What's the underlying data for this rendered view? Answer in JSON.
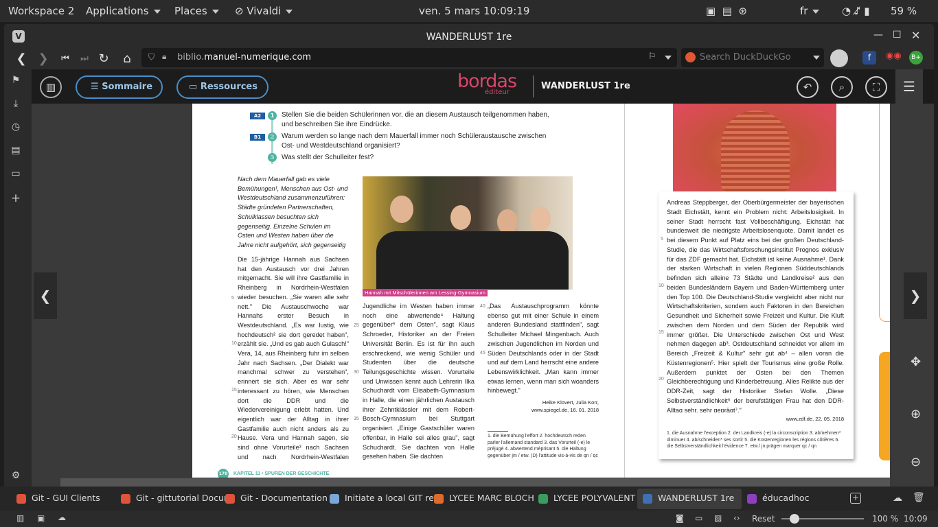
{
  "panel": {
    "workspace": "Workspace 2",
    "applications": "Applications",
    "places": "Places",
    "vivaldi": "Vivaldi",
    "datetime": "ven. 5 mars  10:09:19",
    "lang": "fr",
    "battery": "59 %"
  },
  "window": {
    "title": "WANDERLUST 1re"
  },
  "address": {
    "host": "biblio.",
    "domain": "manuel-numerique.com",
    "search_placeholder": "Search DuckDuckGo"
  },
  "app": {
    "sommaire": "Sommaire",
    "ressources": "Ressources",
    "logo_main": "bordas",
    "logo_sub": "éditeur",
    "title": "WANDERLUST 1re"
  },
  "page": {
    "questions": [
      {
        "badge": "A2",
        "num": "1",
        "text": "Stellen Sie die beiden Schülerinnen vor, die an diesem Austausch teilgenommen haben, und beschreiben Sie ihre Eindrücke."
      },
      {
        "badge": "B1",
        "num": "2",
        "text": "Warum werden so lange nach dem Mauerfall immer noch Schüleraustausche zwischen Ost- und Westdeutschland organisiert?"
      },
      {
        "badge": "",
        "num": "3",
        "text": "Was stellt der Schulleiter fest?"
      }
    ],
    "intro": "Nach dem Mauerfall gab es viele Bemühungen¹, Menschen aus Ost- und Westdeutschland zusammenzuführen: Städte gründeten Partnerschaften, Schulklassen besuchten sich gegenseitig. Einzelne Schulen im Osten und Westen haben über die Jahre nicht aufgehört, sich gegenseitig zu besuchen.",
    "col1": "Die 15-jährige Hannah aus Sachsen hat den Austausch vor drei Jahren mitgemacht. Sie will ihre Gastfamilie in Rheinberg in Nordrhein-Westfalen wieder besuchen. „Sie waren alle sehr nett.\" Die Austauschwoche war Hannahs erster Besuch in Westdeutschland. „Es war lustig, wie hochdeutsch² sie dort geredet haben\", erzählt sie. „Und es gab auch Gulasch!\" Vera, 14, aus Rheinberg fuhr im selben Jahr nach Sachsen. „Der Dialekt war manchmal schwer zu verstehen\", erinnert sie sich. Aber es war sehr interessant zu hören, wie Menschen dort die DDR und die Wiedervereinigung erlebt hatten. Und eigentlich war der Alltag in ihrer Gastfamilie auch nicht anders als zu Hause. Vera und Hannah sagen, sie sind ohne Vorurteile³ nach Sachsen und nach Nordrhein-Westfalen gefahren. „Doch viele",
    "caption": "Hannah mit Mitschülerinnen am Lessing-Gymnasium",
    "col2": "Jugendliche im Westen haben immer noch eine abwertende⁴ Haltung gegenüber⁵ dem Osten\", sagt Klaus Schroeder, Historiker an der Freien Universität Berlin. Es ist für ihn auch erschreckend, wie wenig Schüler und Studenten über die deutsche Teilungsgeschichte wissen. Vorurteile und Unwissen kennt auch Lehrerin Ilka Schuchardt vom Elisabeth-Gymnasium in Halle, die einen jährlichen Austausch ihrer Zehntklässler mit dem Robert-Bosch-Gymnasium bei Stuttgart organisiert. „Einige Gastschüler waren offenbar, in Halle sei alles grau\", sagt Schuchardt. Sie dachten von Halle gesehen haben. Sie dachten",
    "col2_end": "offenbar, in Halle sei alles grau\", sagt Schuchardt.",
    "col3": "„Das Austauschprogramm könnte ebenso gut mit einer Schule in einem anderen Bundesland stattfinden\", sagt Schulleiter Michael Mingenbach. Auch zwischen Jugendlichen im Norden und Süden Deutschlands oder in der Stadt und auf dem Land herrscht eine andere Lebenswirklichkeit. „Man kann immer etwas lernen, wenn man sich woanders hinbewegt.\"",
    "source1": "Heike Klovert, Julia Korr,",
    "source2": "www.spiegel.de, 16. 01. 2018",
    "notes": "1. die Bemühung l'effort  2. hochdeutsch reden parler l'allemand standard  3. das Vorurteil (-e) le préjugé  4. abwertend méprisant  5. die Haltung gegenüber jm / etw. (D) l'attitude vis-à-vis de qn / qc",
    "footer": "KAPITEL 11 • SPUREN DER GESCHICHTE",
    "footer_num": "170",
    "right_text": "Andreas Steppberger, der Oberbürgermeister der bayerischen Stadt Eichstätt, kennt ein Problem nicht: Arbeitslosigkeit. In seiner Stadt herrscht fast Vollbeschäftigung. Eichstätt hat bundesweit die niedrigste Arbeitslosenquote. Damit landet es bei diesem Punkt auf Platz eins bei der großen Deutschland-Studie, die das Wirtschaftsforschungsinstitut Prognos exklusiv für das ZDF gemacht hat. Eichstätt ist keine Ausnahme¹. Dank der starken Wirtschaft in vielen Regionen Süddeutschlands befinden sich alleine 73 Städte und Landkreise² aus den beiden Bundesländern Bayern und Baden-Württemberg unter den Top 100. Die Deutschland-Studie vergleicht aber nicht nur Wirtschaftskriterien, sondern auch Faktoren in den Bereichen Gesundheit und Sicherheit sowie Freizeit und Kultur. Die Kluft zwischen dem Norden und dem Süden der Republik wird immer größer. Die Unterschiede zwischen Ost und West nehmen dagegen ab³. Ostdeutschland schneidet vor allem im Bereich „Freizeit & Kultur\" sehr gut ab⁴ – allen voran die Küstenregionen⁵. Hier spielt der Tourismus eine große Rolle. Außerdem punktet der Osten bei den Themen Gleichberechtigung und Kinderbetreuung. Alles Relikte aus der DDR-Zeit, sagt der Historiker Stefan Wolle. „Diese Selbstverständlichkeit⁶ der berufstätigen Frau hat den DDR-Alltag sehr, sehr geprägt⁷.\"",
    "right_source": "www.zdf.de, 22. 05. 2018",
    "right_notes": "1. die Ausnahme l'exception  2. der Landkreis (-e) la circonscription  3. ab/nehmen* diminuer  4. ab/schneiden* ses sortir  5. die Küstenregionen les régions côtières  6. die Selbstverständlichkeit l'évidence  7. etw./ jn prägen marquer qc / qn"
  },
  "tabs": [
    {
      "label": "Git - GUI Clients",
      "color": "#e0533b"
    },
    {
      "label": "Git - gittutorial Docum",
      "color": "#e0533b"
    },
    {
      "label": "Git - Documentation",
      "color": "#e0533b"
    },
    {
      "label": "Initiate a local GIT rep",
      "color": "#7aa7d8"
    },
    {
      "label": "LYCEE MARC BLOCH",
      "color": "#e06a2c"
    },
    {
      "label": "LYCEE POLYVALENT",
      "color": "#3a9c5f"
    },
    {
      "label": "WANDERLUST 1re",
      "color": "#3f6fb5"
    },
    {
      "label": "éducadhoc",
      "color": "#8e3fc0"
    }
  ],
  "status": {
    "reset": "Reset",
    "zoom": "100 %",
    "time": "10:09"
  }
}
